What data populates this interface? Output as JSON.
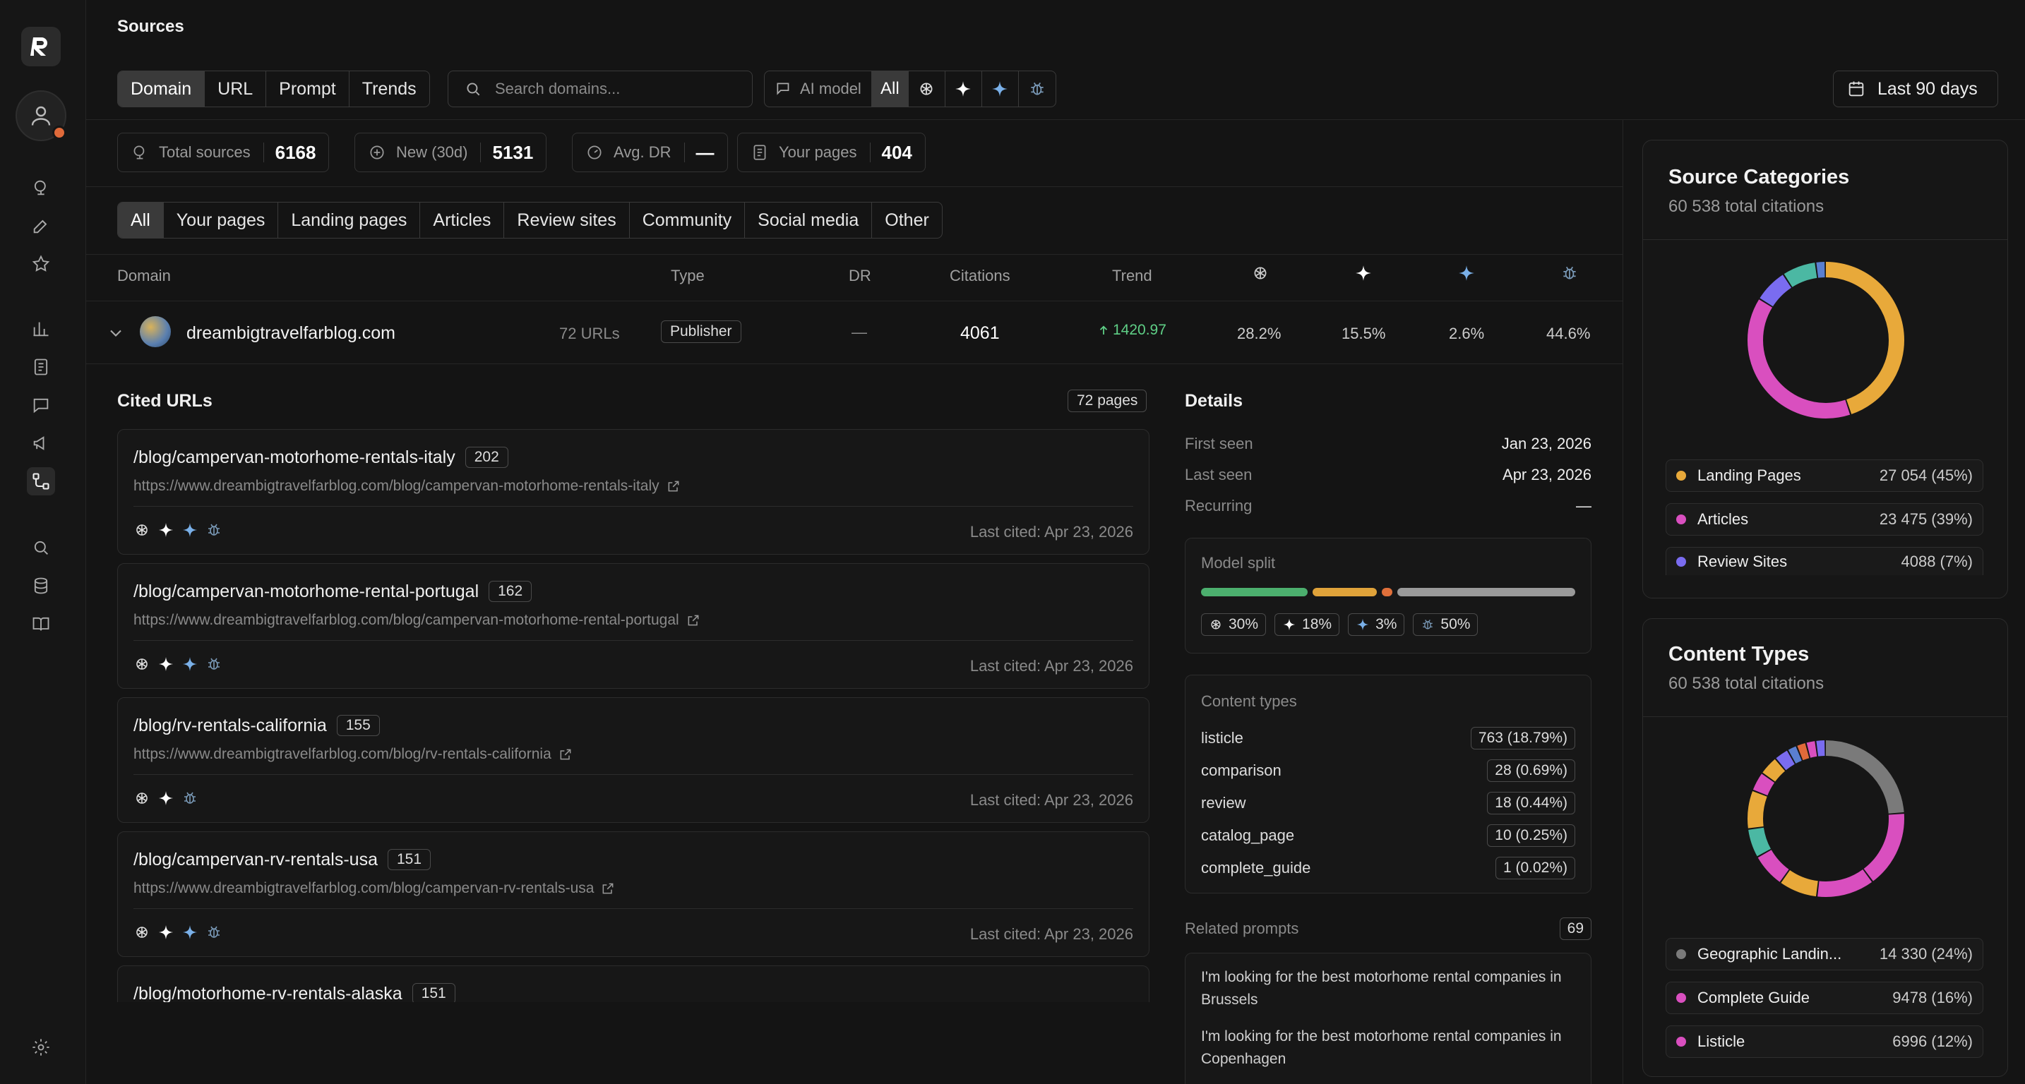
{
  "header": {
    "title": "Sources"
  },
  "view_tabs": [
    {
      "label": "Domain",
      "selected": true
    },
    {
      "label": "URL",
      "selected": false
    },
    {
      "label": "Prompt",
      "selected": false
    },
    {
      "label": "Trends",
      "selected": false
    }
  ],
  "search": {
    "placeholder": "Search domains..."
  },
  "model_filter": {
    "label": "AI model",
    "all_label": "All",
    "models": [
      "openai-icon",
      "sparkle-icon",
      "gemini-icon",
      "bug-icon"
    ]
  },
  "date_range": {
    "label": "Last 90 days"
  },
  "stats": [
    {
      "label": "Total sources",
      "value": "6168",
      "icon": "globe-icon"
    },
    {
      "label": "New (30d)",
      "value": "5131",
      "icon": "plus-circle-icon"
    },
    {
      "label": "Avg. DR",
      "value": "—",
      "icon": "gauge-icon"
    },
    {
      "label": "Your pages",
      "value": "404",
      "icon": "page-icon"
    }
  ],
  "type_tabs": [
    "All",
    "Your pages",
    "Landing pages",
    "Articles",
    "Review sites",
    "Community",
    "Social media",
    "Other"
  ],
  "table": {
    "headers": {
      "domain": "Domain",
      "type": "Type",
      "dr": "DR",
      "citations": "Citations",
      "trend": "Trend"
    },
    "row": {
      "domain": "dreambigtravelfarblog.com",
      "urls": "72 URLs",
      "type": "Publisher",
      "dr": "—",
      "citations": "4061",
      "trend": "1420.97",
      "m1": "28.2%",
      "m2": "15.5%",
      "m3": "2.6%",
      "m4": "44.6%"
    }
  },
  "cited_urls": {
    "title": "Cited URLs",
    "count_label": "72 pages",
    "items": [
      {
        "path": "/blog/campervan-motorhome-rentals-italy",
        "count": "202",
        "url": "https://www.dreambigtravelfarblog.com/blog/campervan-motorhome-rentals-italy",
        "last": "Last cited: Apr 23, 2026"
      },
      {
        "path": "/blog/campervan-motorhome-rental-portugal",
        "count": "162",
        "url": "https://www.dreambigtravelfarblog.com/blog/campervan-motorhome-rental-portugal",
        "last": "Last cited: Apr 23, 2026"
      },
      {
        "path": "/blog/rv-rentals-california",
        "count": "155",
        "url": "https://www.dreambigtravelfarblog.com/blog/rv-rentals-california",
        "last": "Last cited: Apr 23, 2026"
      },
      {
        "path": "/blog/campervan-rv-rentals-usa",
        "count": "151",
        "url": "https://www.dreambigtravelfarblog.com/blog/campervan-rv-rentals-usa",
        "last": "Last cited: Apr 23, 2026"
      },
      {
        "path": "/blog/motorhome-rv-rentals-alaska",
        "count": "151",
        "url": "",
        "last": ""
      }
    ]
  },
  "details": {
    "title": "Details",
    "first_seen_label": "First seen",
    "first_seen": "Jan 23, 2026",
    "last_seen_label": "Last seen",
    "last_seen": "Apr 23, 2026",
    "recurring_label": "Recurring",
    "recurring": "—",
    "model_split": {
      "label": "Model split",
      "chips": [
        "30%",
        "18%",
        "3%",
        "50%"
      ],
      "fractions": [
        0.3,
        0.18,
        0.03,
        0.5
      ],
      "colors": [
        "#4caf6e",
        "#e0a33a",
        "#e0703a",
        "#9a9a9a"
      ]
    },
    "content_types": {
      "label": "Content types",
      "items": [
        {
          "name": "listicle",
          "value": "763 (18.79%)"
        },
        {
          "name": "comparison",
          "value": "28 (0.69%)"
        },
        {
          "name": "review",
          "value": "18 (0.44%)"
        },
        {
          "name": "catalog_page",
          "value": "10 (0.25%)"
        },
        {
          "name": "complete_guide",
          "value": "1 (0.02%)"
        }
      ]
    },
    "related_prompts": {
      "label": "Related prompts",
      "count": "69",
      "items": [
        "I'm looking for the best motorhome rental companies in Brussels",
        "I'm looking for the best motorhome rental companies in Copenhagen"
      ]
    }
  },
  "source_categories": {
    "title": "Source Categories",
    "subtitle": "60 538 total citations",
    "legend": [
      {
        "name": "Landing Pages",
        "value": "27 054 (45%)",
        "color": "#e8a93a"
      },
      {
        "name": "Articles",
        "value": "23 475 (39%)",
        "color": "#d94fbf"
      },
      {
        "name": "Review Sites",
        "value": "4088 (7%)",
        "color": "#7a6cf0"
      }
    ],
    "slices": [
      {
        "fraction": 0.45,
        "color": "#e8a93a"
      },
      {
        "fraction": 0.39,
        "color": "#d94fbf"
      },
      {
        "fraction": 0.07,
        "color": "#7a6cf0"
      },
      {
        "fraction": 0.07,
        "color": "#4bb8a3"
      },
      {
        "fraction": 0.02,
        "color": "#5a7fd0"
      }
    ]
  },
  "content_types_panel": {
    "title": "Content Types",
    "subtitle": "60 538 total citations",
    "legend": [
      {
        "name": "Geographic Landin...",
        "value": "14 330 (24%)",
        "color": "#7a7a7a"
      },
      {
        "name": "Complete Guide",
        "value": "9478 (16%)",
        "color": "#d94fbf"
      },
      {
        "name": "Listicle",
        "value": "6996 (12%)",
        "color": "#d94fbf"
      }
    ],
    "slices": [
      {
        "fraction": 0.24,
        "color": "#7a7a7a"
      },
      {
        "fraction": 0.16,
        "color": "#d94fbf"
      },
      {
        "fraction": 0.12,
        "color": "#d94fbf"
      },
      {
        "fraction": 0.08,
        "color": "#e8a93a"
      },
      {
        "fraction": 0.07,
        "color": "#d94fbf"
      },
      {
        "fraction": 0.06,
        "color": "#4bb8a3"
      },
      {
        "fraction": 0.08,
        "color": "#e8a93a"
      },
      {
        "fraction": 0.04,
        "color": "#d94fbf"
      },
      {
        "fraction": 0.04,
        "color": "#e8a93a"
      },
      {
        "fraction": 0.03,
        "color": "#7a6cf0"
      },
      {
        "fraction": 0.02,
        "color": "#5a7fd0"
      },
      {
        "fraction": 0.02,
        "color": "#e06a3a"
      },
      {
        "fraction": 0.02,
        "color": "#d94fbf"
      },
      {
        "fraction": 0.02,
        "color": "#7a6cf0"
      }
    ]
  }
}
